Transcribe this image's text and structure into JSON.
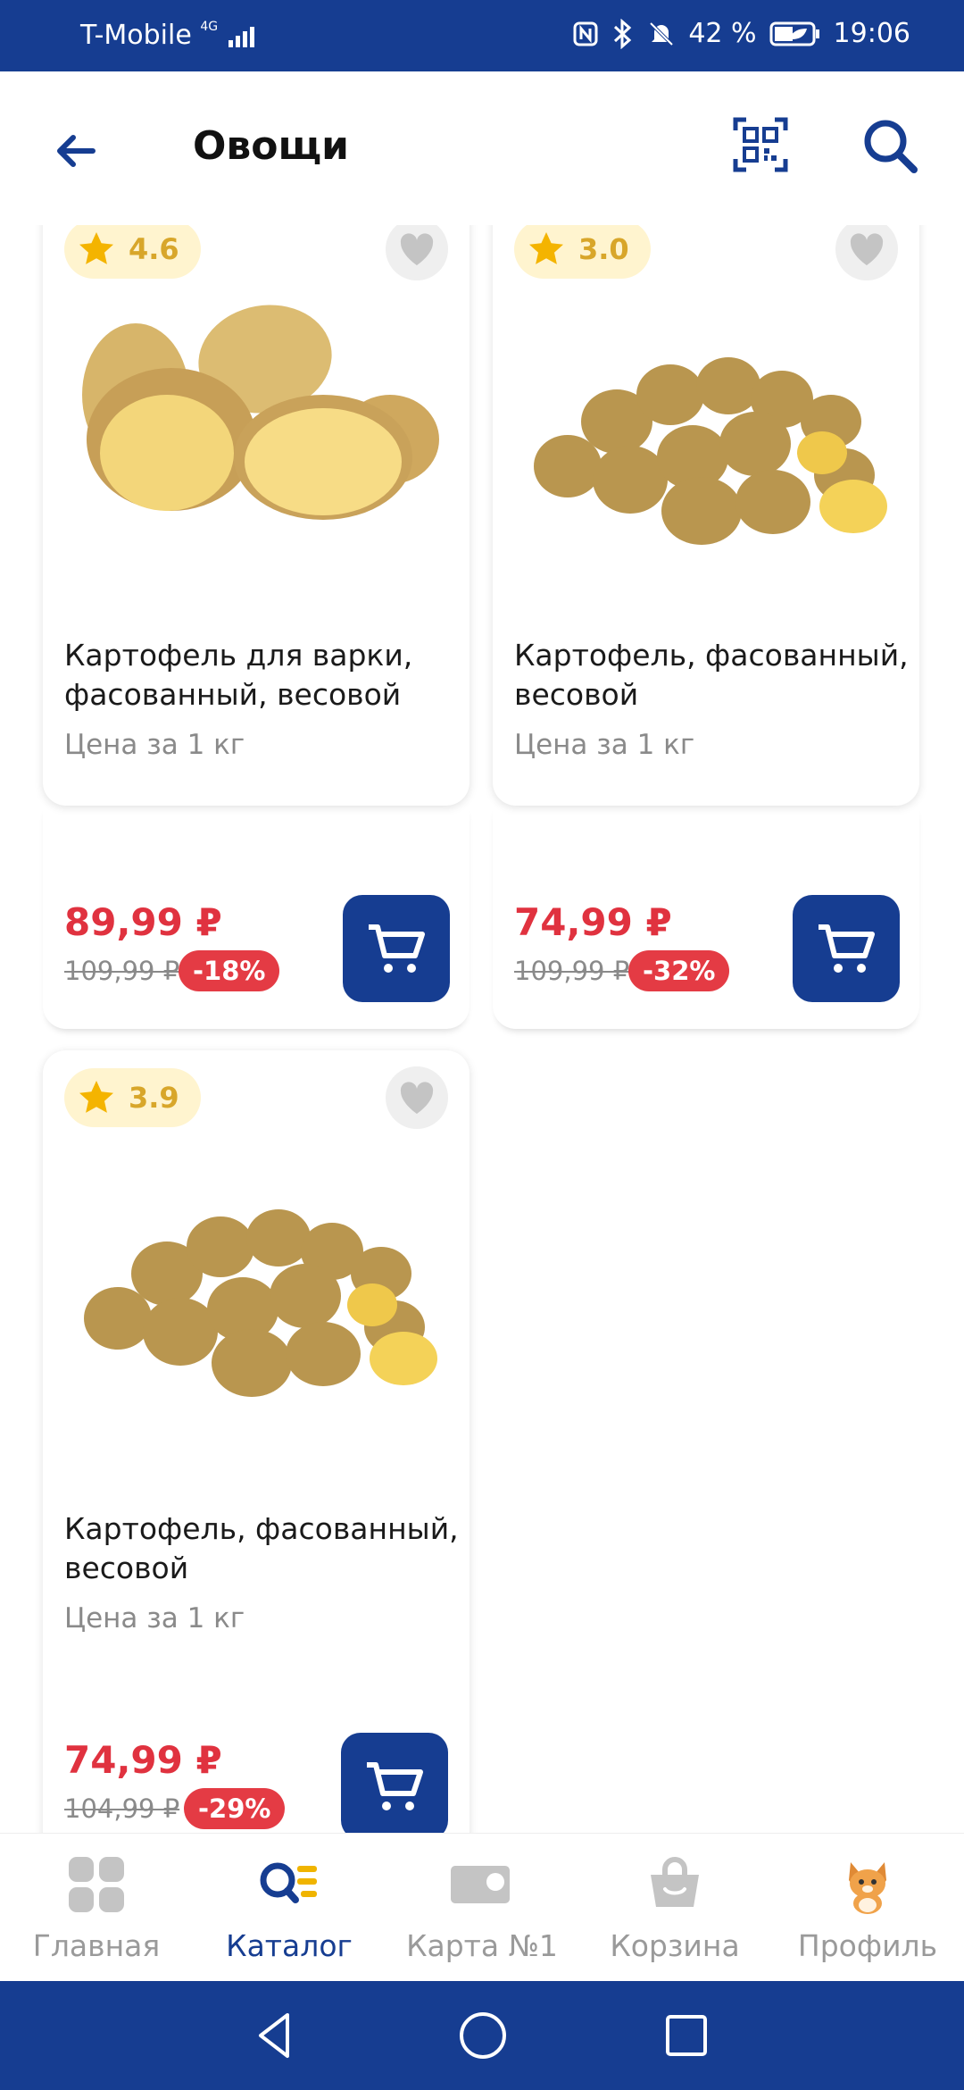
{
  "status_bar": {
    "carrier": "T-Mobile",
    "network": "4G",
    "battery": "42 %",
    "time": "19:06"
  },
  "header": {
    "title": "Овощи"
  },
  "products": [
    {
      "rating": "4.6",
      "name_line1": "Картофель для варки,",
      "name_line2": "фасованный, весовой",
      "unit": "Цена за 1 кг",
      "price": "89,99 ₽",
      "old_price": "109,99 ₽",
      "discount": "-18%"
    },
    {
      "rating": "3.0",
      "name_line1": "Картофель, фасованный,",
      "name_line2": "весовой",
      "unit": "Цена за 1 кг",
      "price": "74,99 ₽",
      "old_price": "109,99 ₽",
      "discount": "-32%"
    },
    {
      "rating": "3.9",
      "name_line1": "Картофель, фасованный,",
      "name_line2": "весовой",
      "unit": "Цена за 1 кг",
      "price": "74,99 ₽",
      "old_price": "104,99 ₽",
      "discount": "-29%"
    }
  ],
  "bottom_nav": [
    {
      "label": "Главная",
      "icon": "home-grid-icon"
    },
    {
      "label": "Каталог",
      "icon": "catalog-search-icon",
      "active": true
    },
    {
      "label": "Карта №1",
      "icon": "loyalty-card-icon"
    },
    {
      "label": "Корзина",
      "icon": "basket-icon"
    },
    {
      "label": "Профиль",
      "icon": "cat-avatar-icon"
    }
  ],
  "colors": {
    "brand": "#163d91",
    "price": "#e0323f",
    "rating_bg": "#fff4cf",
    "star": "#f4b400"
  }
}
